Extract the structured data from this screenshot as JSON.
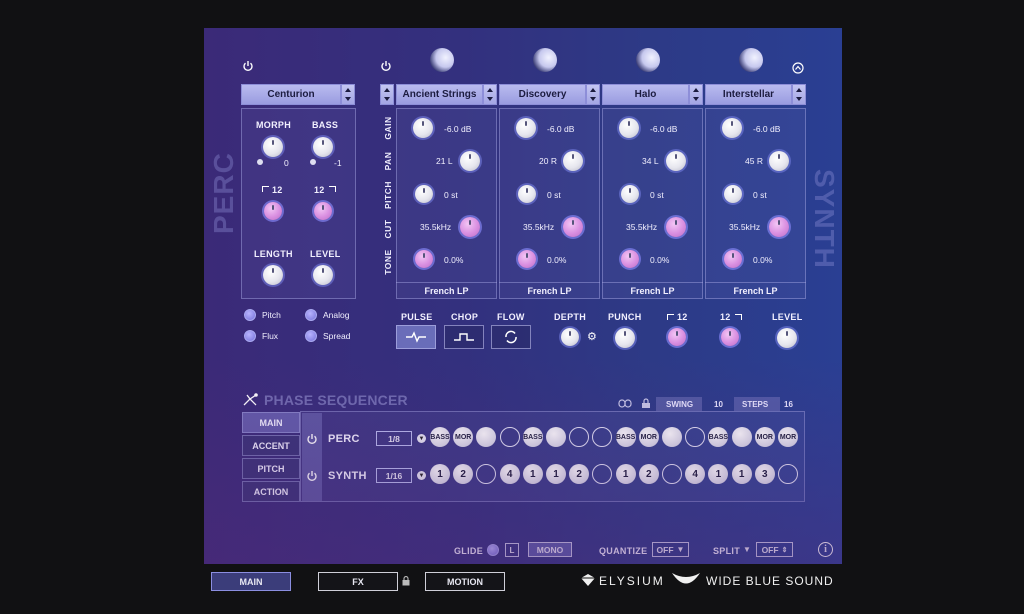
{
  "perc": {
    "side_label": "PERC",
    "preset": "Centurion",
    "morph_label": "MORPH",
    "morph_value": "0",
    "bass_label": "BASS",
    "bass_value": "-1",
    "filter_left_label": "12",
    "filter_right_label": "12",
    "length_label": "LENGTH",
    "level_label": "LEVEL",
    "options": [
      "Pitch",
      "Analog",
      "Flux",
      "Spread"
    ]
  },
  "synth": {
    "side_label": "SYNTH",
    "row_labels": [
      "GAIN",
      "PAN",
      "PITCH",
      "CUT",
      "TONE"
    ],
    "layers": [
      {
        "name": "Ancient Strings",
        "gain": "-6.0 dB",
        "pan": "21 L",
        "pitch": "0 st",
        "cut": "35.5kHz",
        "tone": "0.0%",
        "filter": "French LP"
      },
      {
        "name": "Discovery",
        "gain": "-6.0 dB",
        "pan": "20 R",
        "pitch": "0 st",
        "cut": "35.5kHz",
        "tone": "0.0%",
        "filter": "French LP"
      },
      {
        "name": "Halo",
        "gain": "-6.0 dB",
        "pan": "34 L",
        "pitch": "0 st",
        "cut": "35.5kHz",
        "tone": "0.0%",
        "filter": "French LP"
      },
      {
        "name": "Interstellar",
        "gain": "-6.0 dB",
        "pan": "45 R",
        "pitch": "0 st",
        "cut": "35.5kHz",
        "tone": "0.0%",
        "filter": "French LP"
      }
    ],
    "modes": [
      "PULSE",
      "CHOP",
      "FLOW"
    ],
    "depth_label": "DEPTH",
    "punch_label": "PUNCH",
    "filter_left_label": "12",
    "filter_right_label": "12",
    "level_label": "LEVEL"
  },
  "sequencer": {
    "title": "PHASE SEQUENCER",
    "swing_label": "SWING",
    "swing_value": "10",
    "steps_label": "STEPS",
    "steps_value": "16",
    "tabs": [
      "MAIN",
      "ACCENT",
      "PITCH",
      "ACTION"
    ],
    "rows": [
      {
        "name": "PERC",
        "rate": "1/8",
        "steps": [
          "BASS",
          "MOR",
          "",
          "",
          "BASS",
          "",
          "",
          "",
          "BASS",
          "MOR",
          "",
          "",
          "BASS",
          "",
          "MOR",
          "MOR"
        ],
        "filled": [
          1,
          1,
          1,
          0,
          1,
          1,
          0,
          0,
          1,
          1,
          1,
          0,
          1,
          1,
          1,
          1
        ]
      },
      {
        "name": "SYNTH",
        "rate": "1/16",
        "steps": [
          "1",
          "2",
          "",
          "4",
          "1",
          "1",
          "2",
          "",
          "1",
          "2",
          "",
          "4",
          "1",
          "1",
          "3",
          ""
        ],
        "filled": [
          1,
          1,
          0,
          1,
          1,
          1,
          1,
          0,
          1,
          1,
          0,
          1,
          1,
          1,
          1,
          0
        ]
      }
    ]
  },
  "bottom_controls": {
    "glide_label": "GLIDE",
    "glide_l": "L",
    "mono_label": "MONO",
    "quantize_label": "QUANTIZE",
    "quantize_value": "OFF",
    "split_label": "SPLIT",
    "split_value": "OFF"
  },
  "nav": {
    "tabs": [
      "MAIN",
      "FX",
      "MOTION"
    ],
    "brand_product": "ELYSIUM",
    "brand_company": "WIDE BLUE SOUND"
  },
  "colors": {
    "accent": "#8b8ee0",
    "knob_pink": "#d98ee0"
  }
}
